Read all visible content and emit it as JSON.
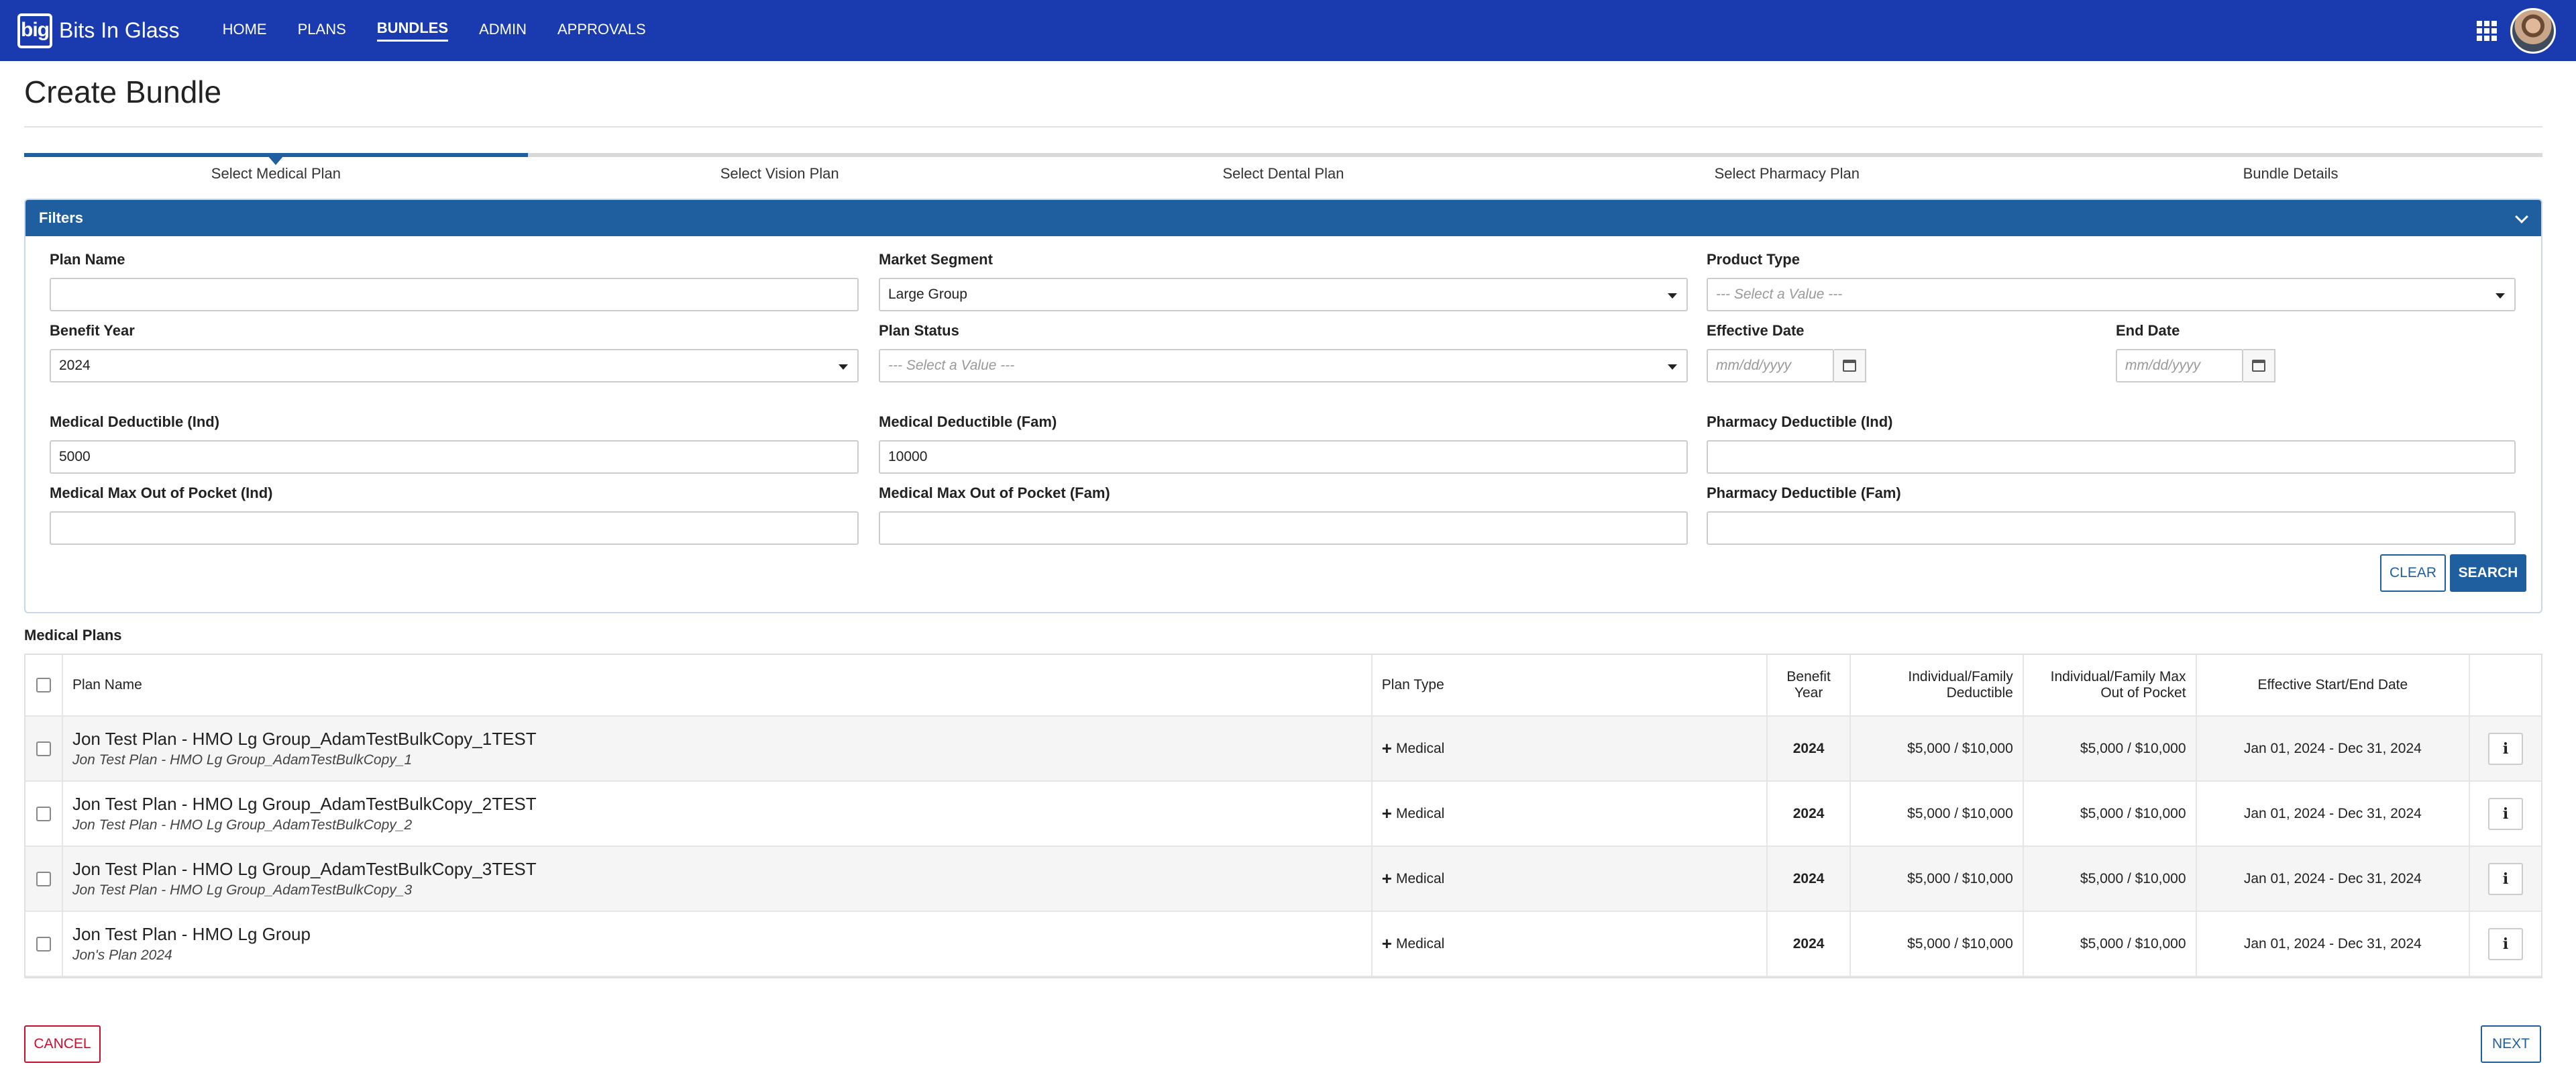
{
  "app": {
    "brand_logo": "big",
    "brand_name": "Bits In Glass",
    "nav": [
      "HOME",
      "PLANS",
      "BUNDLES",
      "ADMIN",
      "APPROVALS"
    ],
    "active_nav": "BUNDLES"
  },
  "page": {
    "title": "Create Bundle"
  },
  "stepper": {
    "steps": [
      "Select Medical Plan",
      "Select Vision Plan",
      "Select Dental Plan",
      "Select Pharmacy Plan",
      "Bundle Details"
    ],
    "current_step": 1,
    "total_steps": 5
  },
  "filters": {
    "title": "Filters",
    "plan_name": {
      "label": "Plan Name",
      "value": ""
    },
    "market_segment": {
      "label": "Market Segment",
      "value": "Large Group"
    },
    "product_type": {
      "label": "Product Type",
      "placeholder": "--- Select a Value ---"
    },
    "benefit_year": {
      "label": "Benefit Year",
      "value": "2024"
    },
    "plan_status": {
      "label": "Plan Status",
      "placeholder": "--- Select a Value ---"
    },
    "effective_date": {
      "label": "Effective Date",
      "placeholder": "mm/dd/yyyy"
    },
    "end_date": {
      "label": "End Date",
      "placeholder": "mm/dd/yyyy"
    },
    "med_ded_ind": {
      "label": "Medical Deductible (Ind)",
      "value": "5000"
    },
    "med_ded_fam": {
      "label": "Medical Deductible (Fam)",
      "value": "10000"
    },
    "pharm_ded_ind": {
      "label": "Pharmacy Deductible (Ind)",
      "value": ""
    },
    "med_oop_ind": {
      "label": "Medical Max Out of Pocket (Ind)",
      "value": ""
    },
    "med_oop_fam": {
      "label": "Medical Max Out of Pocket (Fam)",
      "value": ""
    },
    "pharm_ded_fam": {
      "label": "Pharmacy Deductible (Fam)",
      "value": ""
    },
    "clear_label": "CLEAR",
    "search_label": "SEARCH"
  },
  "table": {
    "section_title": "Medical Plans",
    "headers": {
      "plan_name": "Plan Name",
      "plan_type": "Plan Type",
      "benefit_year_1": "Benefit",
      "benefit_year_2": "Year",
      "deductible_1": "Individual/Family",
      "deductible_2": "Deductible",
      "oop_1": "Individual/Family Max",
      "oop_2": "Out of Pocket",
      "dates": "Effective Start/End Date"
    },
    "rows": [
      {
        "name": "Jon Test Plan - HMO Lg Group_AdamTestBulkCopy_1TEST",
        "sub": "Jon Test Plan - HMO Lg Group_AdamTestBulkCopy_1",
        "type": "Medical",
        "year": "2024",
        "deductible": "$5,000 / $10,000",
        "oop": "$5,000 / $10,000",
        "dates": "Jan 01, 2024 - Dec 31, 2024"
      },
      {
        "name": "Jon Test Plan - HMO Lg Group_AdamTestBulkCopy_2TEST",
        "sub": "Jon Test Plan - HMO Lg Group_AdamTestBulkCopy_2",
        "type": "Medical",
        "year": "2024",
        "deductible": "$5,000 / $10,000",
        "oop": "$5,000 / $10,000",
        "dates": "Jan 01, 2024 - Dec 31, 2024"
      },
      {
        "name": "Jon Test Plan - HMO Lg Group_AdamTestBulkCopy_3TEST",
        "sub": "Jon Test Plan - HMO Lg Group_AdamTestBulkCopy_3",
        "type": "Medical",
        "year": "2024",
        "deductible": "$5,000 / $10,000",
        "oop": "$5,000 / $10,000",
        "dates": "Jan 01, 2024 - Dec 31, 2024"
      },
      {
        "name": "Jon Test Plan - HMO Lg Group",
        "sub": "Jon's Plan 2024",
        "type": "Medical",
        "year": "2024",
        "deductible": "$5,000 / $10,000",
        "oop": "$5,000 / $10,000",
        "dates": "Jan 01, 2024 - Dec 31, 2024"
      }
    ],
    "info_glyph": "i"
  },
  "footer": {
    "cancel_label": "CANCEL",
    "next_label": "NEXT"
  },
  "colors": {
    "nav_bg": "#1a3bb0",
    "accent": "#1f5fa0",
    "danger": "#c8102e"
  }
}
